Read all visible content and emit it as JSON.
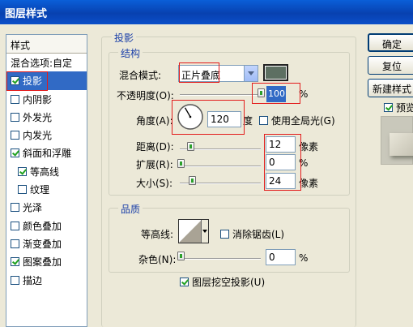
{
  "window": {
    "title": "图层样式"
  },
  "style_list": {
    "header": "样式",
    "items": [
      {
        "label": "混合选项:自定",
        "checkbox": false,
        "checked": false,
        "selected": false,
        "indent": false
      },
      {
        "label": "投影",
        "checkbox": true,
        "checked": true,
        "selected": true,
        "indent": false
      },
      {
        "label": "内阴影",
        "checkbox": true,
        "checked": false,
        "selected": false,
        "indent": false
      },
      {
        "label": "外发光",
        "checkbox": true,
        "checked": false,
        "selected": false,
        "indent": false
      },
      {
        "label": "内发光",
        "checkbox": true,
        "checked": false,
        "selected": false,
        "indent": false
      },
      {
        "label": "斜面和浮雕",
        "checkbox": true,
        "checked": true,
        "selected": false,
        "indent": false
      },
      {
        "label": "等高线",
        "checkbox": true,
        "checked": true,
        "selected": false,
        "indent": true
      },
      {
        "label": "纹理",
        "checkbox": true,
        "checked": false,
        "selected": false,
        "indent": true
      },
      {
        "label": "光泽",
        "checkbox": true,
        "checked": false,
        "selected": false,
        "indent": false
      },
      {
        "label": "颜色叠加",
        "checkbox": true,
        "checked": false,
        "selected": false,
        "indent": false
      },
      {
        "label": "渐变叠加",
        "checkbox": true,
        "checked": false,
        "selected": false,
        "indent": false
      },
      {
        "label": "图案叠加",
        "checkbox": true,
        "checked": true,
        "selected": false,
        "indent": false
      },
      {
        "label": "描边",
        "checkbox": true,
        "checked": false,
        "selected": false,
        "indent": false
      }
    ]
  },
  "drop_shadow": {
    "legend": "投影",
    "structure": {
      "legend": "结构",
      "blend_mode_label": "混合模式:",
      "blend_mode_value": "正片叠底",
      "shadow_color": "#5d6f62",
      "opacity_label": "不透明度(O):",
      "opacity_value": "100",
      "opacity_level": 1.0,
      "angle_label": "角度(A):",
      "angle_value": "120",
      "angle_unit": "度",
      "global_light_label": "使用全局光(G)",
      "global_light_checked": false,
      "distance_label": "距离(D):",
      "distance_value": "12",
      "distance_unit": "像素",
      "spread_label": "扩展(R):",
      "spread_value": "0",
      "size_label": "大小(S):",
      "size_value": "24",
      "size_unit": "像素",
      "percent": "%"
    },
    "quality": {
      "legend": "品质",
      "contour_label": "等高线:",
      "antialias_label": "消除锯齿(L)",
      "antialias_checked": false,
      "noise_label": "杂色(N):",
      "noise_value": "0",
      "percent": "%"
    },
    "knockout_label": "图层挖空投影(U)",
    "knockout_checked": true
  },
  "buttons": {
    "ok": "确定",
    "reset": "复位",
    "new_style": "新建样式",
    "preview_label": "预览",
    "preview_checked": true
  }
}
